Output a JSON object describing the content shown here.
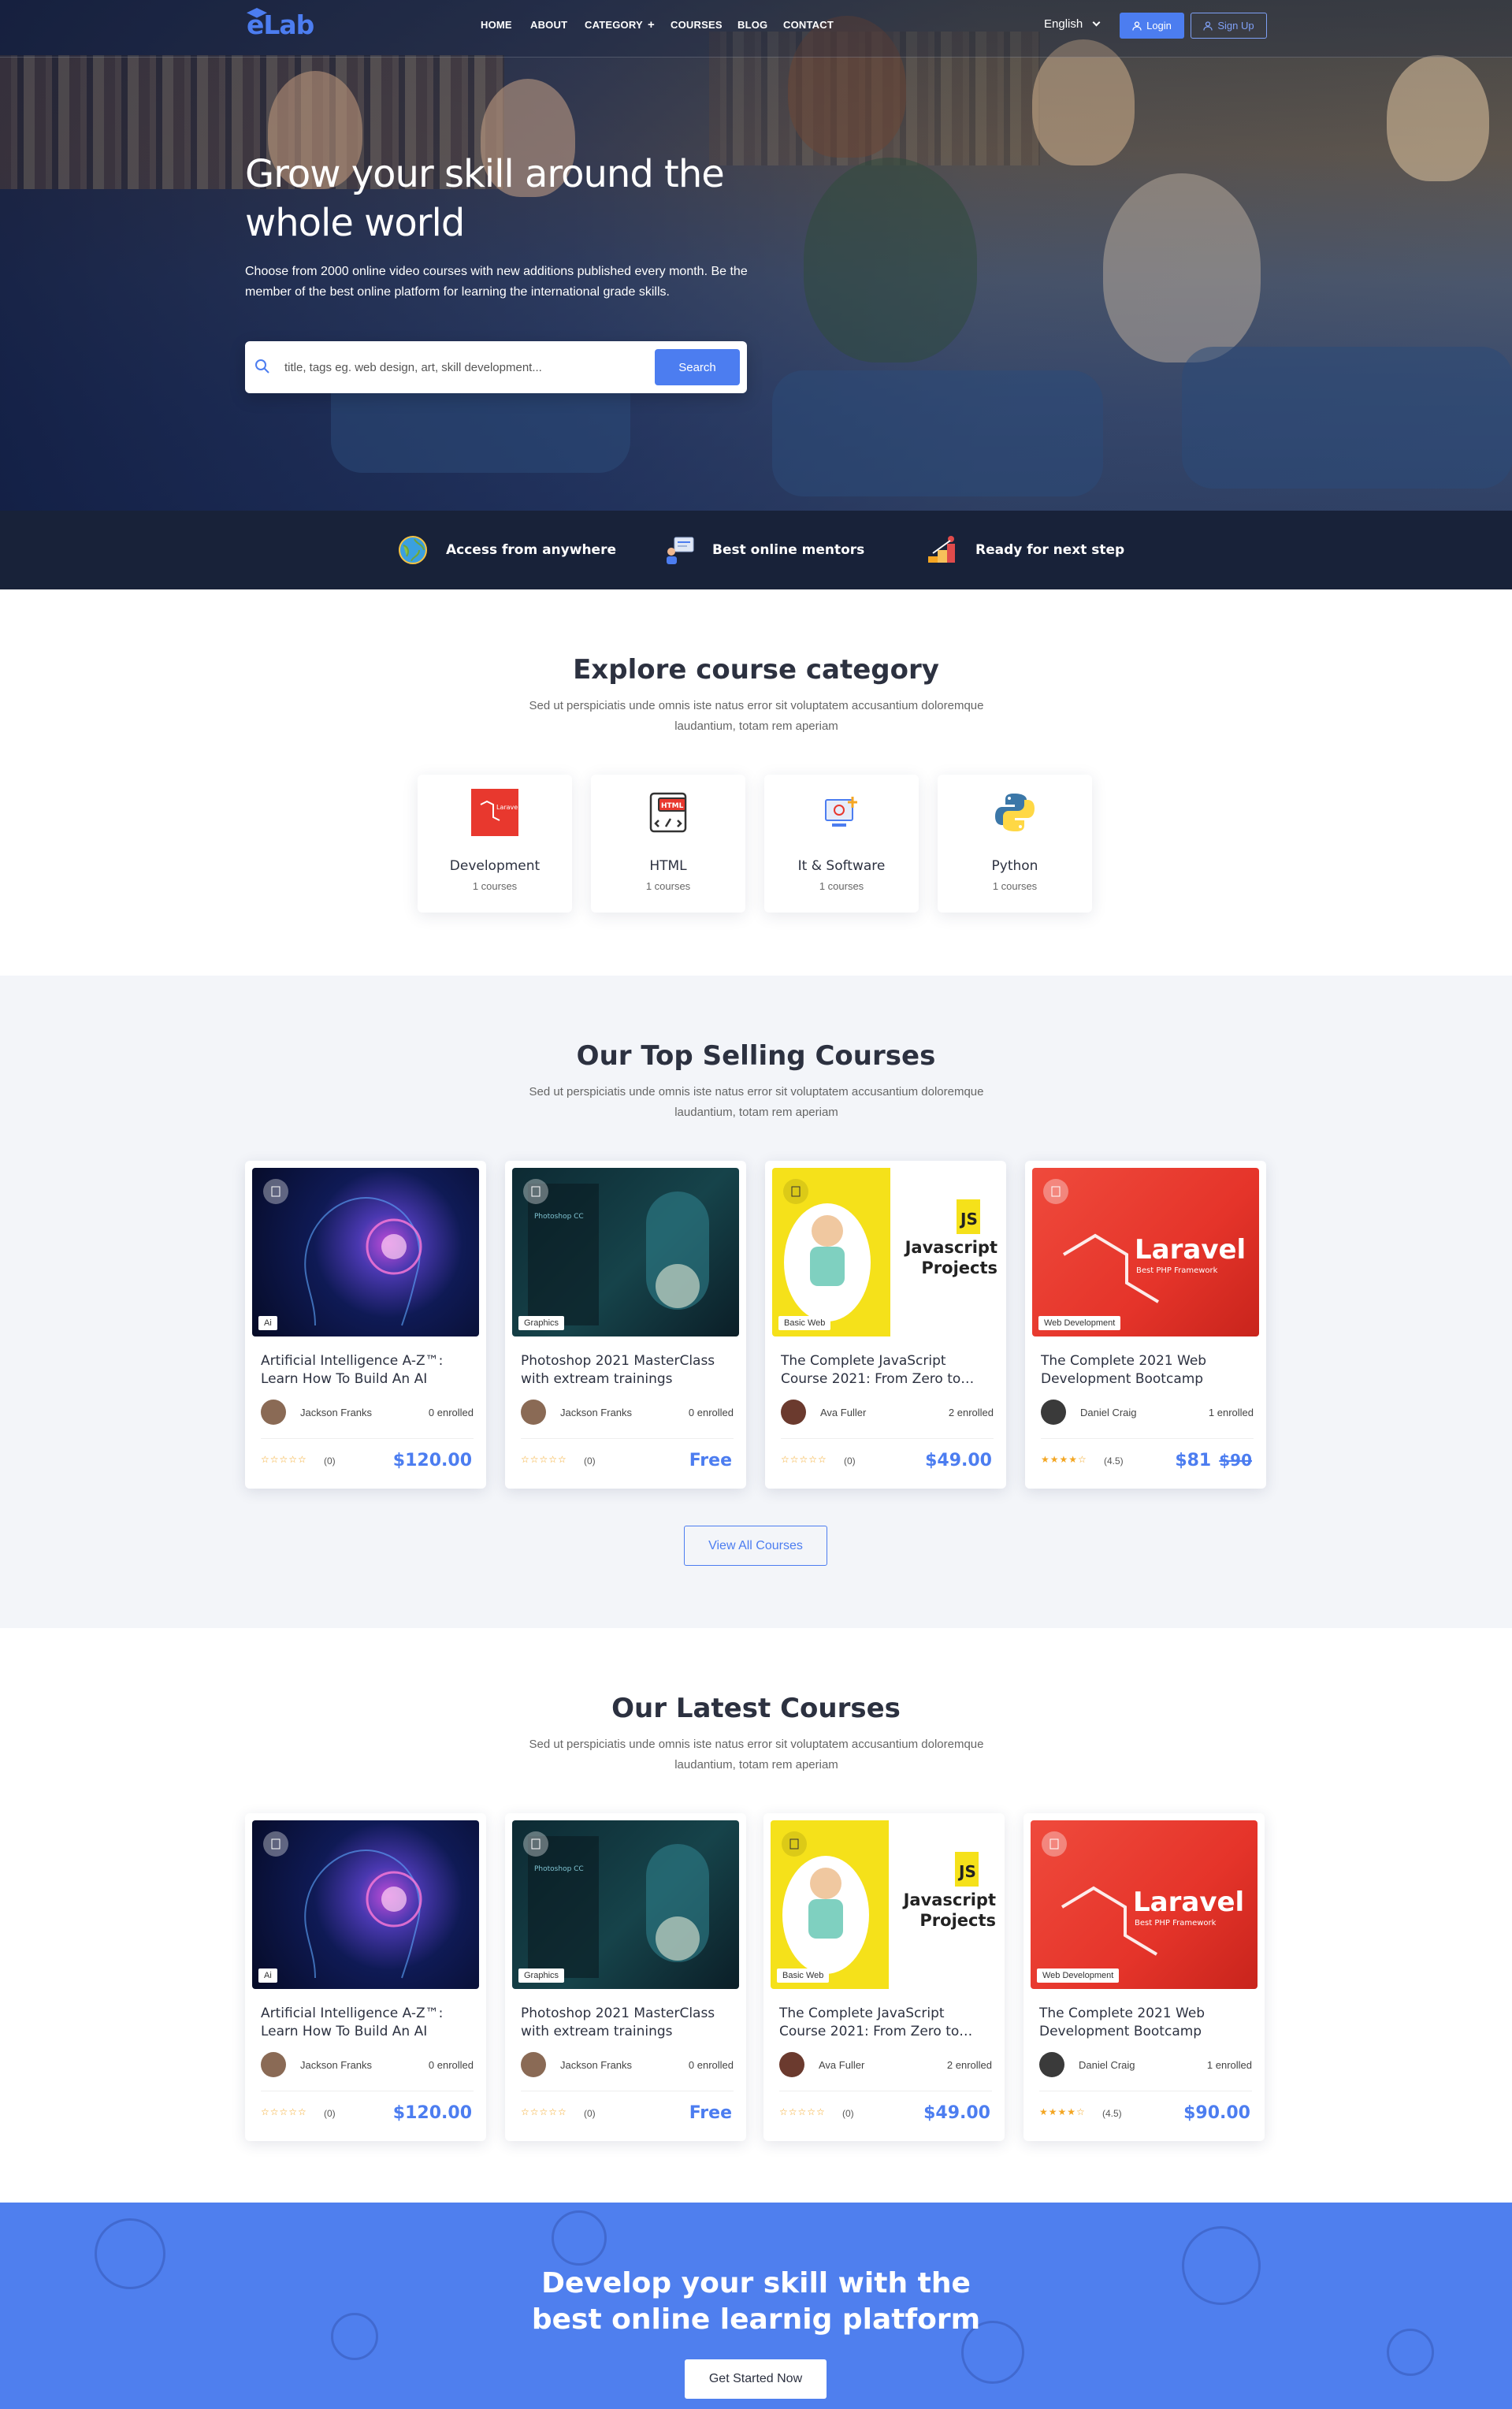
{
  "nav": {
    "logo": "eLab",
    "menu": [
      "HOME",
      "ABOUT",
      "CATEGORY",
      "+",
      "COURSES",
      "BLOG",
      "CONTACT"
    ],
    "language": "English",
    "login": "Login",
    "signup": "Sign Up"
  },
  "hero": {
    "title": "Grow your skill around the whole world",
    "text": "Choose from 2000 online video courses with new additions published every month. Be the member of the best online platform for learning the international grade skills.",
    "search_placeholder": "title, tags eg. web design, art, skill development...",
    "search_button": "Search"
  },
  "features": [
    {
      "label": "Access from anywhere",
      "icon": "globe-icon"
    },
    {
      "label": "Best online mentors",
      "icon": "mentor-icon"
    },
    {
      "label": "Ready for next step",
      "icon": "steps-icon"
    }
  ],
  "explore": {
    "title": "Explore course category",
    "subtitle": "Sed ut perspiciatis unde omnis iste natus error sit voluptatem accusantium doloremque laudantium, totam rem aperiam",
    "categories": [
      {
        "name": "Development",
        "count": "1 courses",
        "icon": "laravel-icon"
      },
      {
        "name": "HTML",
        "count": "1 courses",
        "icon": "html-icon"
      },
      {
        "name": "It & Software",
        "count": "1 courses",
        "icon": "software-icon"
      },
      {
        "name": "Python",
        "count": "1 courses",
        "icon": "python-icon"
      }
    ]
  },
  "top_selling": {
    "title": "Our Top Selling Courses",
    "subtitle": "Sed ut perspiciatis unde omnis iste natus error sit voluptatem accusantium doloremque laudantium, totam rem aperiam",
    "view_all": "View All Courses",
    "courses": [
      {
        "title": "Artificial Intelligence A-Z™: Learn How To Build An AI",
        "tag": "Ai",
        "author": "Jackson Franks",
        "enrolled": "0 enrolled",
        "stars": "☆☆☆☆☆",
        "rating": "(0)",
        "price": "$120.00",
        "old_price": ""
      },
      {
        "title": "Photoshop 2021 MasterClass with extream trainings",
        "tag": "Graphics",
        "author": "Jackson Franks",
        "enrolled": "0 enrolled",
        "stars": "☆☆☆☆☆",
        "rating": "(0)",
        "price": "Free",
        "old_price": ""
      },
      {
        "title": "The Complete JavaScript Course 2021: From Zero to…",
        "tag": "Basic Web",
        "author": "Ava Fuller",
        "enrolled": "2 enrolled",
        "stars": "☆☆☆☆☆",
        "rating": "(0)",
        "price": "$49.00",
        "old_price": ""
      },
      {
        "title": "The Complete 2021 Web Development Bootcamp",
        "tag": "Web Development",
        "author": "Daniel Craig",
        "enrolled": "1 enrolled",
        "stars": "★★★★☆",
        "rating": "(4.5)",
        "price": "$81",
        "old_price": "$90"
      }
    ]
  },
  "latest": {
    "title": "Our Latest Courses",
    "subtitle": "Sed ut perspiciatis unde omnis iste natus error sit voluptatem accusantium doloremque laudantium, totam rem aperiam",
    "courses": [
      {
        "title": "Artificial Intelligence A-Z™: Learn How To Build An AI",
        "tag": "Ai",
        "author": "Jackson Franks",
        "enrolled": "0 enrolled",
        "stars": "☆☆☆☆☆",
        "rating": "(0)",
        "price": "$120.00"
      },
      {
        "title": "Photoshop 2021 MasterClass with extream trainings",
        "tag": "Graphics",
        "author": "Jackson Franks",
        "enrolled": "0 enrolled",
        "stars": "☆☆☆☆☆",
        "rating": "(0)",
        "price": "Free"
      },
      {
        "title": "The Complete JavaScript Course 2021: From Zero to…",
        "tag": "Basic Web",
        "author": "Ava Fuller",
        "enrolled": "2 enrolled",
        "stars": "☆☆☆☆☆",
        "rating": "(0)",
        "price": "$49.00"
      },
      {
        "title": "The Complete 2021 Web Development Bootcamp",
        "tag": "Web Development",
        "author": "Daniel Craig",
        "enrolled": "1 enrolled",
        "stars": "★★★★☆",
        "rating": "(4.5)",
        "price": "$90.00"
      }
    ]
  },
  "thumb_text": {
    "photoshop": "Photoshop CC",
    "js": "JS",
    "js_title": "Javascript Projects",
    "laravel": "Laravel",
    "laravel_sub": "Best PHP Framework"
  },
  "cta": {
    "title": "Develop your skill with the best online learnig platform",
    "button": "Get Started Now"
  },
  "colors": {
    "accent": "#4c7df0",
    "dark": "#182239",
    "text": "#2c3140"
  }
}
